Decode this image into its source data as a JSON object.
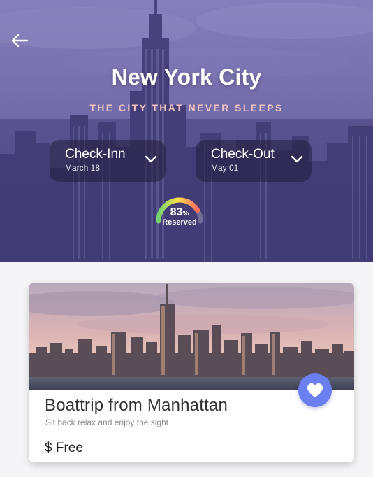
{
  "header": {
    "title": "New York City",
    "subtitle": "THE CITY THAT NEVER SLEEPS"
  },
  "booking": {
    "checkin": {
      "label": "Check-Inn",
      "value": "March 18"
    },
    "checkout": {
      "label": "Check-Out",
      "value": "May 01"
    }
  },
  "reservation": {
    "percent": "83",
    "percent_symbol": "%",
    "label": "Reserved",
    "fraction": 0.83
  },
  "card": {
    "title": "Boattrip from Manhattan",
    "description": "Sit back relax and enjoy the sight",
    "price": "$ Free"
  },
  "icons": {
    "back": "arrow-left-icon",
    "dropdown": "chevron-down-icon",
    "favorite": "heart-icon"
  },
  "colors": {
    "hero_tint": "#5f5a96",
    "subtitle": "#f3c3bf",
    "favorite": "#6b7ff0",
    "gauge_low": "#6fd36f",
    "gauge_mid": "#ffe04a",
    "gauge_high": "#ff6a5c"
  }
}
